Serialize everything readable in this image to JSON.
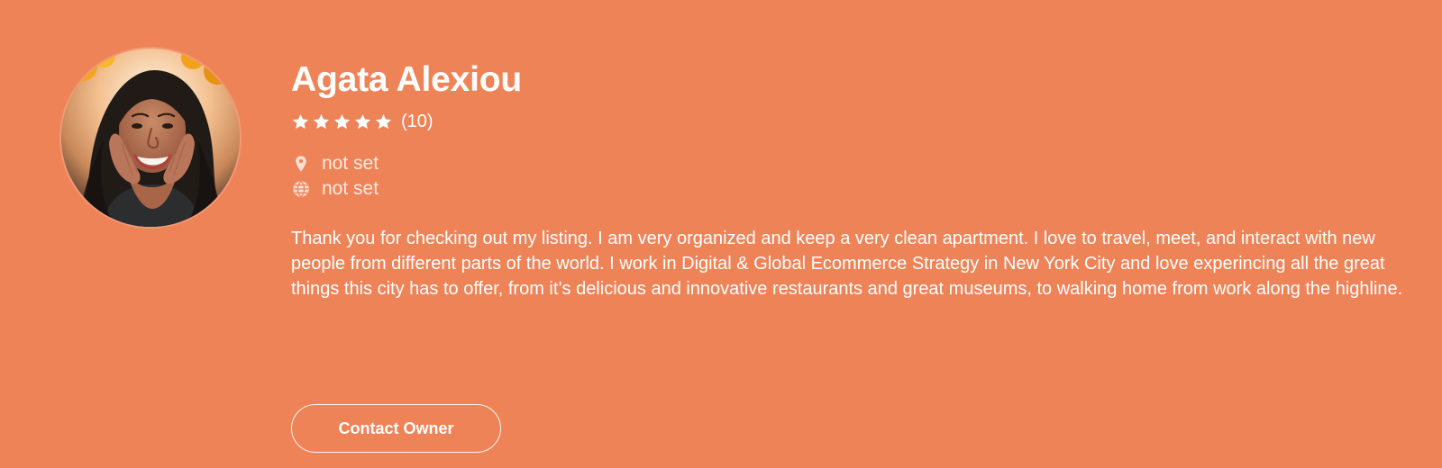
{
  "profile": {
    "name": "Agata Alexiou",
    "rating": {
      "stars": 5,
      "count_label": "(10)"
    },
    "location": {
      "icon": "map-pin-icon",
      "value": "not set"
    },
    "website": {
      "icon": "globe-icon",
      "value": "not set"
    },
    "bio": "Thank you for checking out my listing. I am very organized and keep a very clean apartment. I love to travel, meet, and interact with new people from different parts of the world. I work in Digital & Global Ecommerce Strategy in New York City and love experincing all the great things this city has to offer, from it’s delicious and innovative restaurants and great museums, to walking home from work along the highline.",
    "contact_button_label": "Contact Owner"
  },
  "colors": {
    "background": "#ee8357",
    "text": "#ffffff"
  }
}
